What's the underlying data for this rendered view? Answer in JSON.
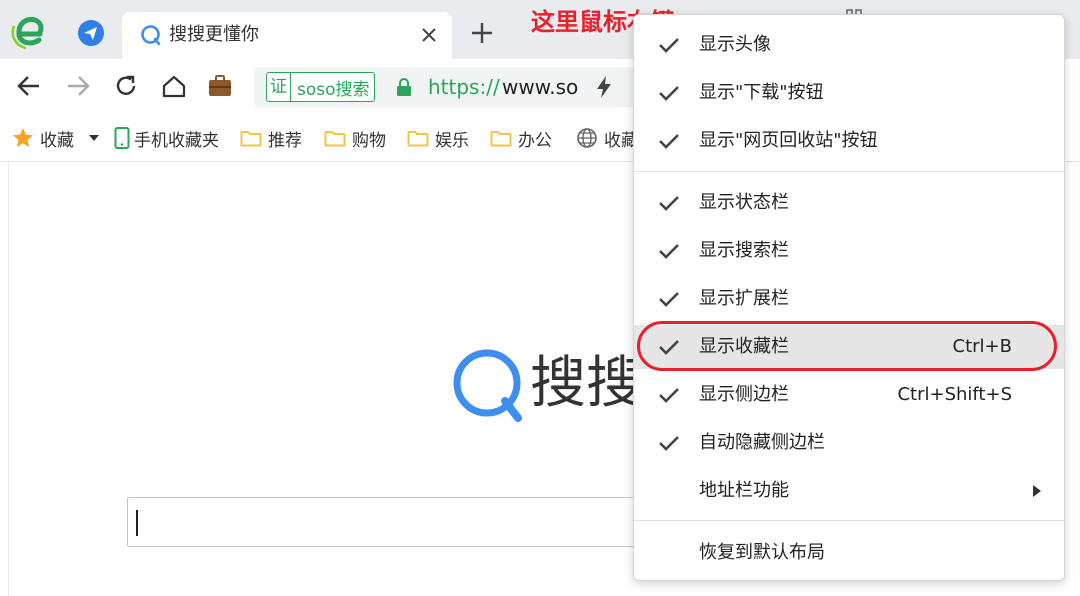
{
  "colors": {
    "accent_green": "#2aa55a",
    "annotation_red": "#e8202b",
    "search_blue": "#3d8ef0",
    "folder_yellow": "#f3c44a",
    "star_orange": "#f5a623"
  },
  "annotation": {
    "text": "这里鼠标右键"
  },
  "tabs": [
    {
      "title": "搜搜更懂你",
      "icon": "soso-q-icon",
      "active": true
    }
  ],
  "toolbar": {
    "buttons": [
      "back-icon",
      "forward-icon",
      "reload-icon",
      "home-icon",
      "briefcase-icon"
    ],
    "address": {
      "cert_mark": "证",
      "cert_name": "soso搜索",
      "protocol": "https://",
      "host": "www.so"
    }
  },
  "bookmarks": {
    "items": [
      {
        "label": "收藏",
        "icon": "star-icon"
      },
      {
        "label": "手机收藏夹",
        "icon": "phone-icon"
      },
      {
        "label": "推荐",
        "icon": "folder-icon"
      },
      {
        "label": "购物",
        "icon": "folder-icon"
      },
      {
        "label": "娱乐",
        "icon": "folder-icon"
      },
      {
        "label": "办公",
        "icon": "folder-icon"
      },
      {
        "label": "收藏",
        "icon": "globe-icon"
      }
    ]
  },
  "page": {
    "brand": "搜搜",
    "search_placeholder": ""
  },
  "context_menu": {
    "groups": [
      [
        {
          "label": "显示头像",
          "checked": true,
          "shortcut": ""
        },
        {
          "label": "显示\"下载\"按钮",
          "checked": true,
          "shortcut": ""
        },
        {
          "label": "显示\"网页回收站\"按钮",
          "checked": true,
          "shortcut": ""
        }
      ],
      [
        {
          "label": "显示状态栏",
          "checked": true,
          "shortcut": ""
        },
        {
          "label": "显示搜索栏",
          "checked": true,
          "shortcut": ""
        },
        {
          "label": "显示扩展栏",
          "checked": true,
          "shortcut": ""
        },
        {
          "label": "显示收藏栏",
          "checked": true,
          "shortcut": "Ctrl+B",
          "highlighted": true
        },
        {
          "label": "显示侧边栏",
          "checked": true,
          "shortcut": "Ctrl+Shift+S"
        },
        {
          "label": "自动隐藏侧边栏",
          "checked": true,
          "shortcut": ""
        },
        {
          "label": "地址栏功能",
          "checked": false,
          "shortcut": "",
          "submenu": true
        }
      ],
      [
        {
          "label": "恢复到默认布局",
          "checked": false,
          "shortcut": ""
        }
      ]
    ]
  }
}
